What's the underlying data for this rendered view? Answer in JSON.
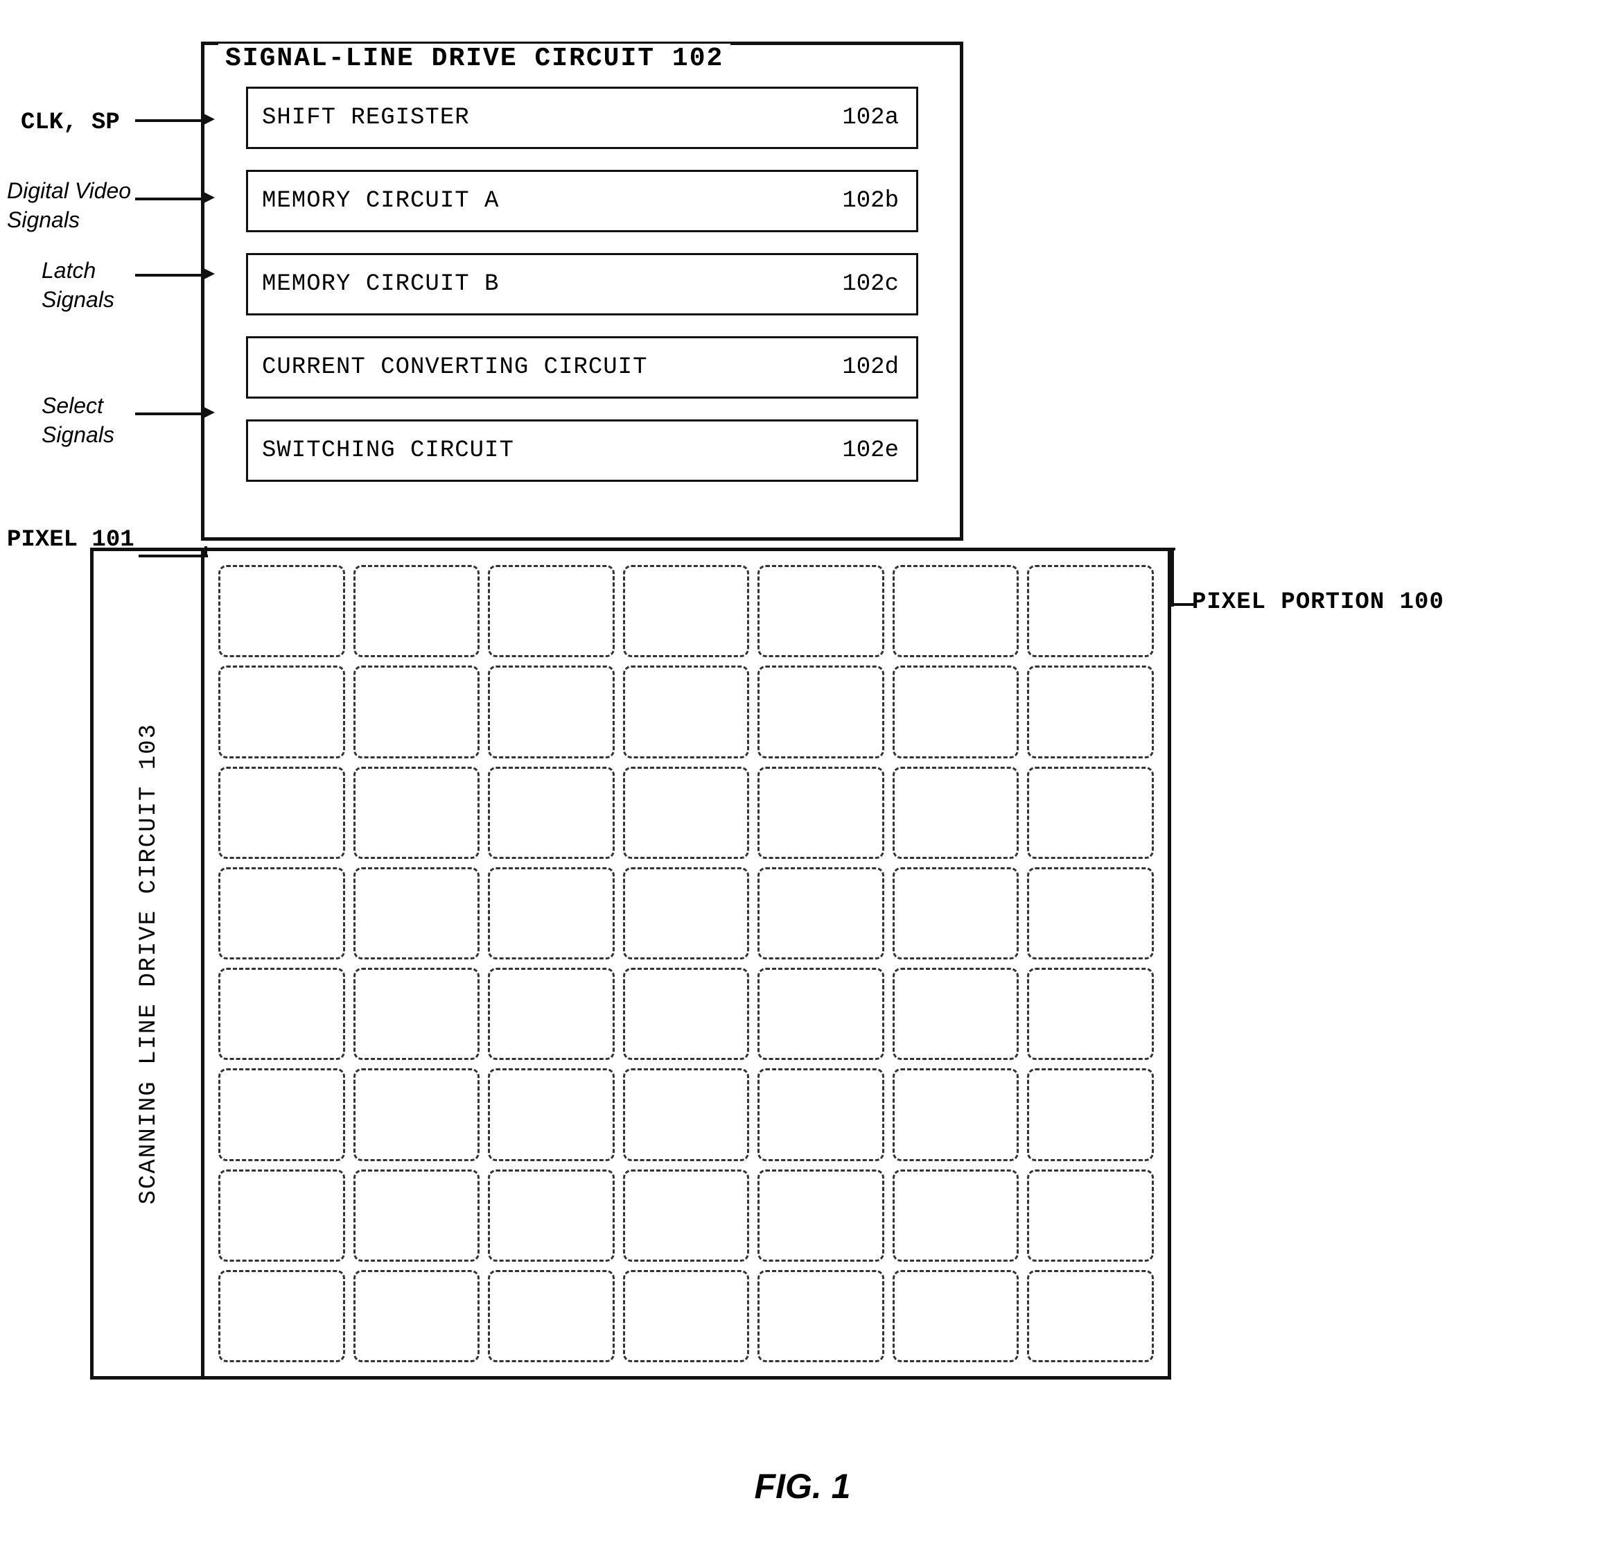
{
  "title": "FIG. 1",
  "signalDrive": {
    "title": "SIGNAL-LINE DRIVE CIRCUIT 102",
    "boxes": [
      {
        "label": "SHIFT REGISTER",
        "id": "102a"
      },
      {
        "label": "MEMORY CIRCUIT A",
        "id": "102b"
      },
      {
        "label": "MEMORY CIRCUIT B",
        "id": "102c"
      },
      {
        "label": "CURRENT CONVERTING CIRCUIT",
        "id": "102d"
      },
      {
        "label": "SWITCHING CIRCUIT",
        "id": "102e"
      }
    ]
  },
  "labels": {
    "clk_sp": "CLK, SP",
    "digital_video": "Digital Video\nSignals",
    "latch": "Latch\nSignals",
    "select": "Select\nSignals",
    "pixel101": "PIXEL 101",
    "pixelPortion": "PIXEL PORTION 100",
    "scanningLine": "SCANNING LINE DRIVE CIRCUIT 103",
    "fig": "FIG. 1"
  },
  "grid": {
    "cols": 7,
    "rows": 8
  }
}
